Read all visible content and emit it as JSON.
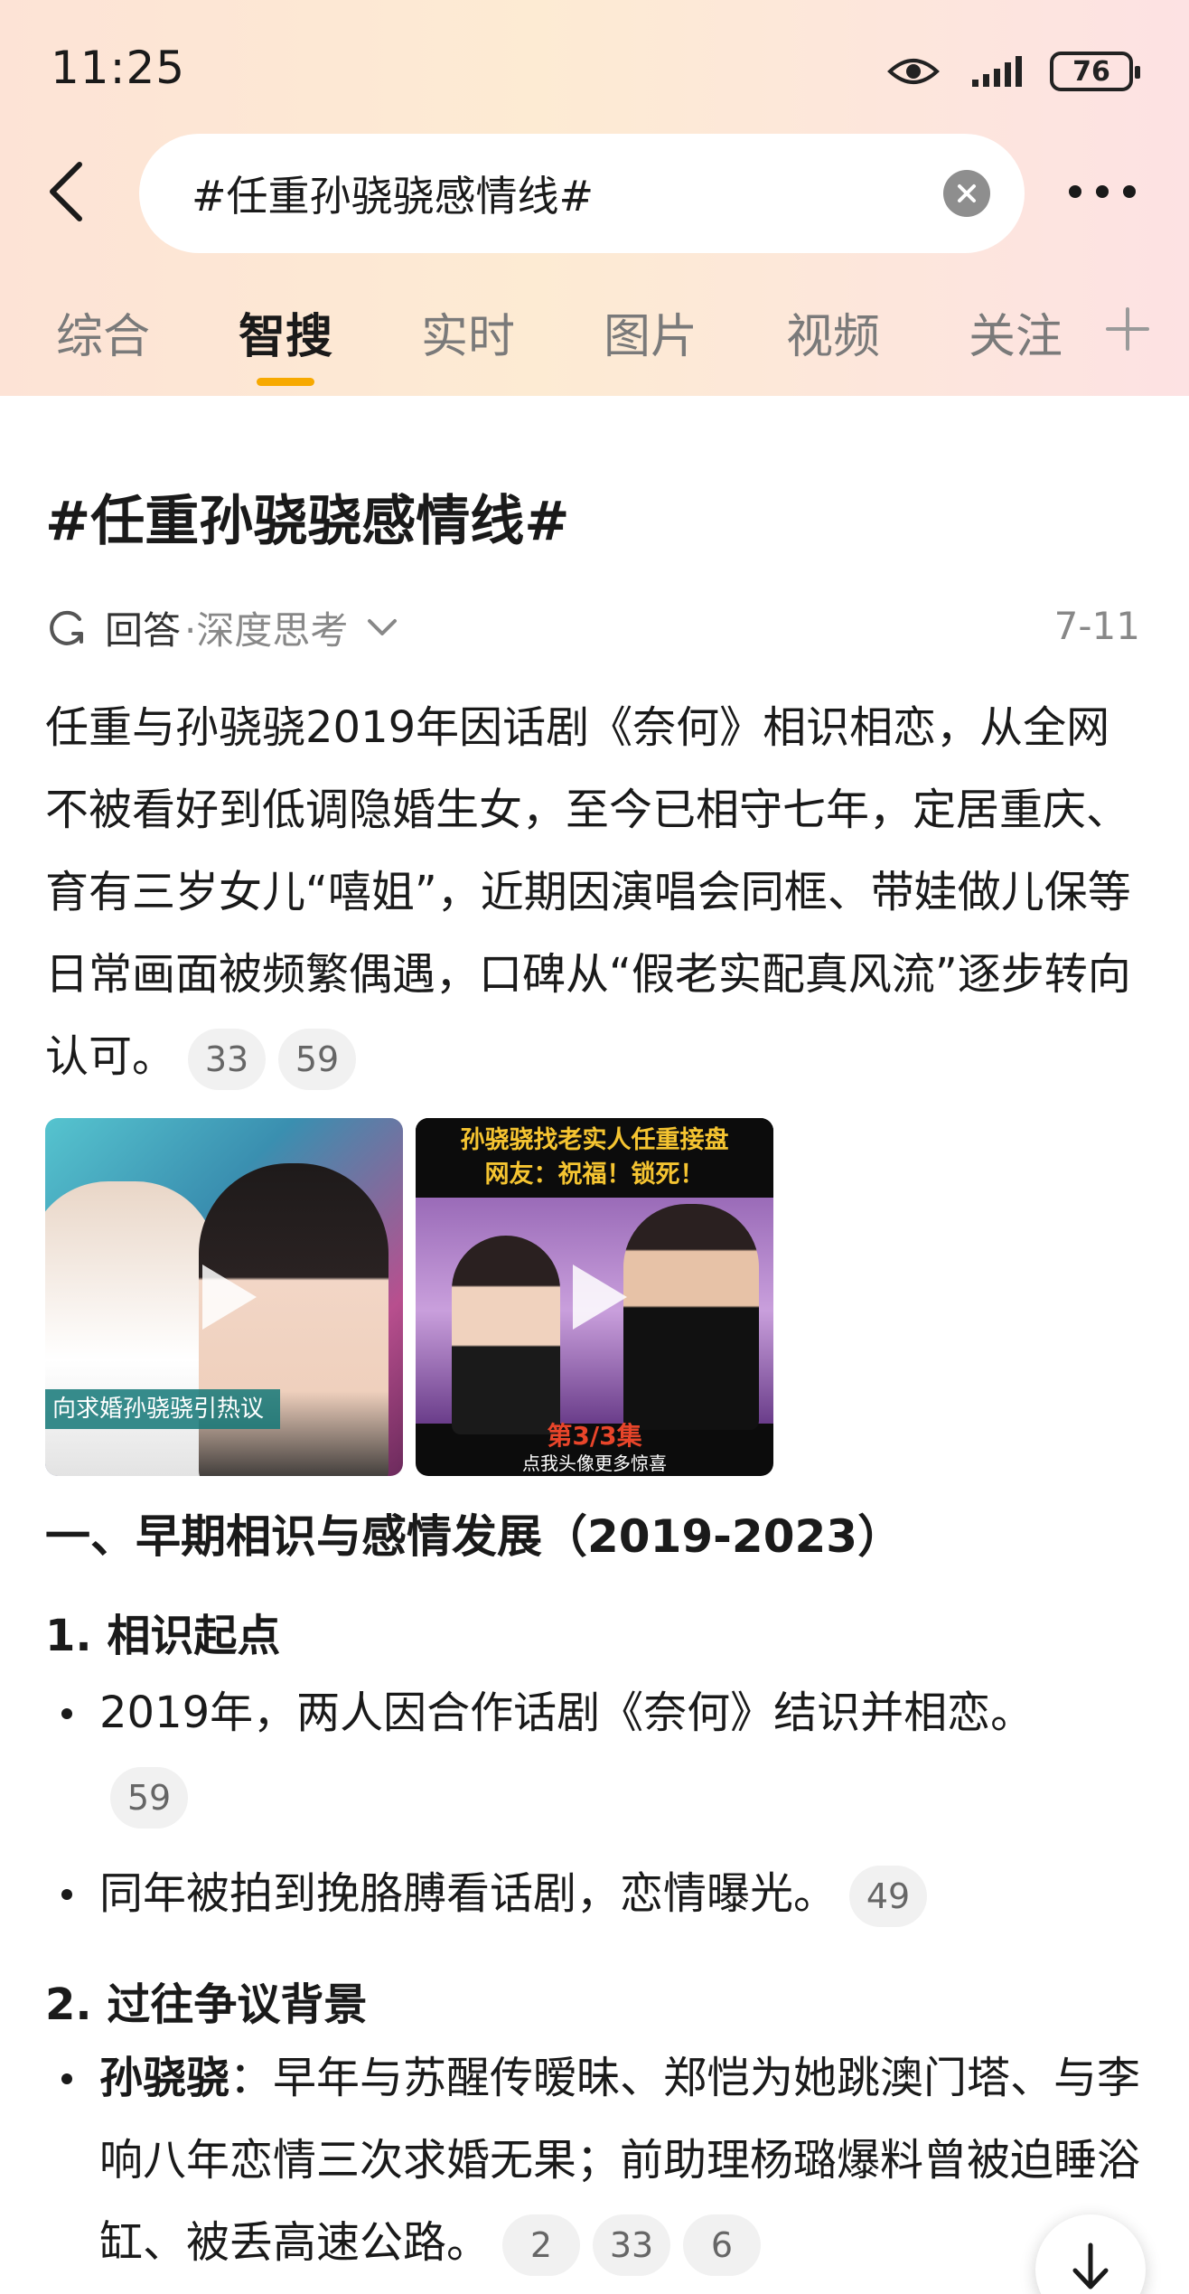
{
  "status_bar": {
    "time": "11:25",
    "battery": "76"
  },
  "search": {
    "query": "#任重孙骁骁感情线#"
  },
  "tabs": [
    {
      "label": "综合"
    },
    {
      "label": "智搜"
    },
    {
      "label": "实时"
    },
    {
      "label": "图片"
    },
    {
      "label": "视频"
    },
    {
      "label": "关注"
    }
  ],
  "active_tab": "智搜",
  "accent_color": "#f7a900",
  "content": {
    "title": "#任重孙骁骁感情线#",
    "answer_label": "回答",
    "answer_mode": "·深度思考",
    "date": "7-11",
    "summary": "任重与孙骁骁2019年因话剧《奈何》相识相恋，从全网不被看好到低调隐婚生女，至今已相守七年，定居重庆、育有三岁女儿“嘻姐”，近期因演唱会同框、带娃做儿保等日常画面被频繁偶遇，口碑从“假老实配真风流”逐步转向认可。",
    "summary_refs": [
      "33",
      "59"
    ],
    "videos": [
      {
        "caption": "向求婚孙骁骁引热议"
      },
      {
        "top_line1": "孙骁骁找老实人任重接盘",
        "top_line2": "网友：祝福！锁死！",
        "episode": "第3/3集",
        "footer": "点我头像更多惊喜"
      }
    ],
    "section1": {
      "heading": "一、早期相识与感情发展（2019-2023）",
      "sub1": {
        "heading": "1. 相识起点",
        "bullets": [
          {
            "text": "2019年，两人因合作话剧《奈何》结识并相恋。",
            "ref": "59"
          },
          {
            "text": "同年被拍到挽胳膊看话剧，恋情曝光。",
            "ref": "49"
          }
        ]
      },
      "sub2": {
        "heading": "2. 过往争议背景",
        "bullets": [
          {
            "lead": "孙骁骁",
            "text": "：早年与苏醒传暧昧、郑恺为她跳澳门塔、与李响八年恋情三次求婚无果；前助理杨璐爆料曾被迫睡浴缸、被丢高速公路。",
            "refs": [
              "2",
              "33",
              "6"
            ]
          }
        ]
      }
    }
  }
}
